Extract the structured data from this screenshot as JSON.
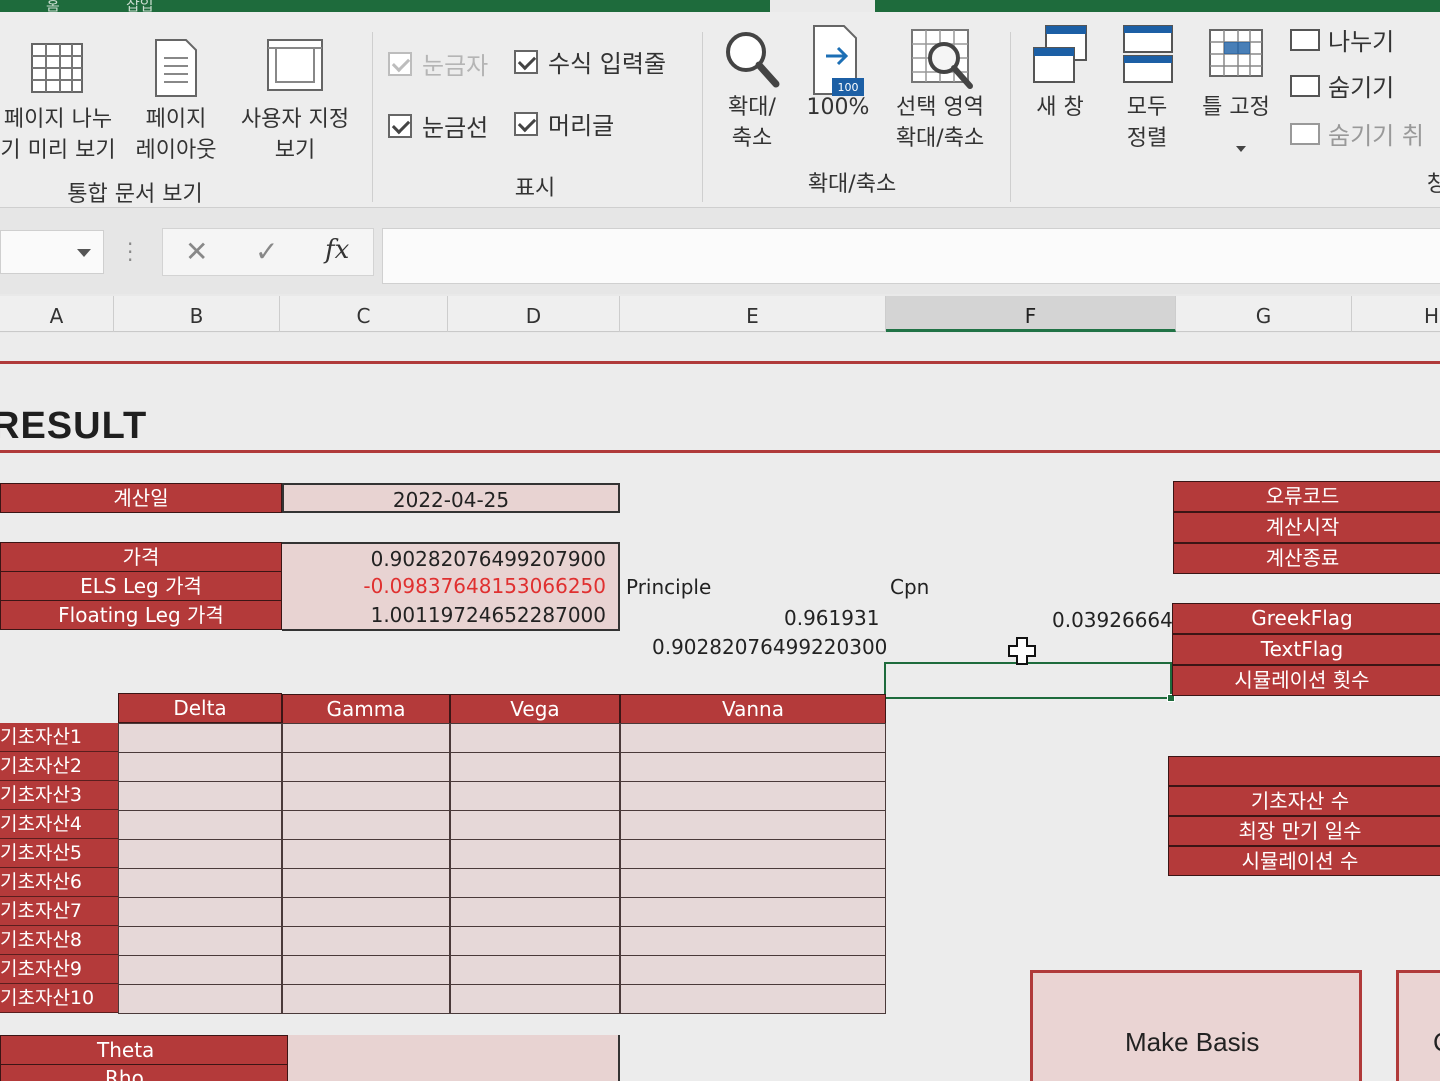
{
  "ribbon": {
    "tabs_partial": [
      "홈",
      "삽입"
    ],
    "view_group": {
      "page_break_label": "페이지 나누",
      "page_break_label2": "기 미리 보기",
      "page_layout_label": "페이지",
      "page_layout_label2": "레이아웃",
      "custom_view_label": "사용자 지정",
      "custom_view_label2": "보기",
      "title": "통합 문서 보기"
    },
    "show_group": {
      "ruler": "눈금자",
      "formula_bar": "수식 입력줄",
      "gridlines": "눈금선",
      "headings": "머리글",
      "title": "표시"
    },
    "zoom_group": {
      "zoom_label": "확대/",
      "zoom_label2": "축소",
      "zoom100_label": "100%",
      "zoom100_badge": "100",
      "zoom_selection_label": "선택 영역",
      "zoom_selection_label2": "확대/축소",
      "title": "확대/축소"
    },
    "window_group": {
      "new_window": "새 창",
      "arrange_all": "모두",
      "arrange_all2": "정렬",
      "freeze_panes": "틀 고정",
      "split": "나누기",
      "hide": "숨기기",
      "unhide": "숨기기 취",
      "title_partial": "창"
    }
  },
  "formula_bar": {
    "cancel": "✕",
    "enter": "✓",
    "fx": "fx",
    "value": ""
  },
  "columns": [
    "A",
    "B",
    "C",
    "D",
    "E",
    "F",
    "G",
    "H"
  ],
  "sheet": {
    "title": "RESULT",
    "calc_date_label": "계산일",
    "calc_date_value": "2022-04-25",
    "price_label": "가격",
    "price_value": "0.90282076499207900",
    "els_leg_label": "ELS Leg 가격",
    "els_leg_value": "-0.09837648153066250",
    "floating_leg_label": "Floating Leg 가격",
    "floating_leg_value": "1.00119724652287000",
    "principle_label": "Principle",
    "principle_value": "0.961931",
    "principle_value2": "0.90282076499220300",
    "cpn_label": "Cpn",
    "cpn_value": "0.03926664",
    "greeks_headers": [
      "Delta",
      "Gamma",
      "Vega",
      "Vanna"
    ],
    "assets": [
      "기초자산1",
      "기초자산2",
      "기초자산3",
      "기초자산4",
      "기초자산5",
      "기초자산6",
      "기초자산7",
      "기초자산8",
      "기초자산9",
      "기초자산10"
    ],
    "theta_label": "Theta",
    "rho_label": "Rho",
    "status_labels": [
      "오류코드",
      "계산시작",
      "계산종료"
    ],
    "flag_labels": [
      "GreekFlag",
      "TextFlag",
      "시뮬레이션 횟수"
    ],
    "info_labels": [
      "",
      "기초자산 수",
      "최장 만기 일수",
      "시뮬레이션 수"
    ],
    "make_basis_button": "Make Basis",
    "second_button_partial": "C"
  },
  "colors": {
    "header_red": "#b43a3a",
    "value_pink": "#e8d3d2",
    "excel_green": "#1e6b3c",
    "negative_red": "#e03030"
  }
}
